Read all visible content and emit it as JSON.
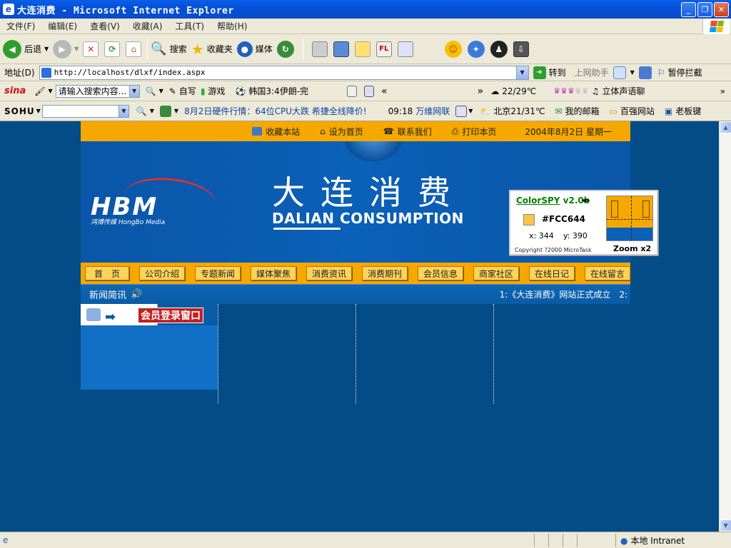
{
  "window": {
    "title": "大连消费 - Microsoft Internet Explorer"
  },
  "menubar": {
    "items": [
      "文件(F)",
      "编辑(E)",
      "查看(V)",
      "收藏(A)",
      "工具(T)",
      "帮助(H)"
    ]
  },
  "toolbar": {
    "back_label": "后退",
    "search_label": "搜索",
    "favorites_label": "收藏夹",
    "media_label": "媒体"
  },
  "address": {
    "label": "地址(D)",
    "url": "http://localhost/dlxf/index.aspx",
    "go_label": "转到",
    "helper_label": "上网助手",
    "block_label": "暂停拦截"
  },
  "sinabar": {
    "search_placeholder": "请输入搜索内容...",
    "diary_label": "自写",
    "game_label": "游戏",
    "score_text": "韩国3:4伊朗-完",
    "guillemet_left": "«",
    "guillemet_right": "»",
    "weather_text": "22/29℃",
    "chat_label": "立体声语聊"
  },
  "sohubar": {
    "logo": "SOHU",
    "news_text": "8月2日硬件行情：64位CPU大跌 希捷全线降价!",
    "clock": "09:18",
    "network_label": "万维网联",
    "weather_text": "北京21/31℃",
    "mail_label": "我的邮箱",
    "baiqiang_label": "百强网站",
    "laoban_label": "老板键"
  },
  "page": {
    "topbar": {
      "favorite_label": "收藏本站",
      "homepage_label": "设为首页",
      "contact_label": "联系我们",
      "print_label": "打印本页",
      "date_text": "2004年8月2日 星期一"
    },
    "banner": {
      "logo_text": "HBM",
      "logo_sub": "鸿博传媒 HongBo Media",
      "title_cn": "大连消费",
      "title_en": "DALIAN CONSUMPTION"
    },
    "nav": [
      "首　页",
      "公司介绍",
      "专题新闻",
      "媒体聚焦",
      "消费资讯",
      "消费期刊",
      "会员信息",
      "商家社区",
      "在线日记",
      "在线留言"
    ],
    "news": {
      "label": "新闻简讯",
      "ticker": "1:《大连消费》网站正式成立　2:"
    },
    "login_title": "会员登录窗口"
  },
  "colorspy": {
    "name": "ColorSPY",
    "version": "v2.0b",
    "color_hex": "#FCC644",
    "x_text": "x: 344",
    "y_text": "y: 390",
    "copyright": "Copyright ?2000 MicroTask",
    "zoom_label": "Zoom x2",
    "swatch_color": "#FCC644"
  },
  "statusbar": {
    "zone_label": "本地 Intranet"
  }
}
